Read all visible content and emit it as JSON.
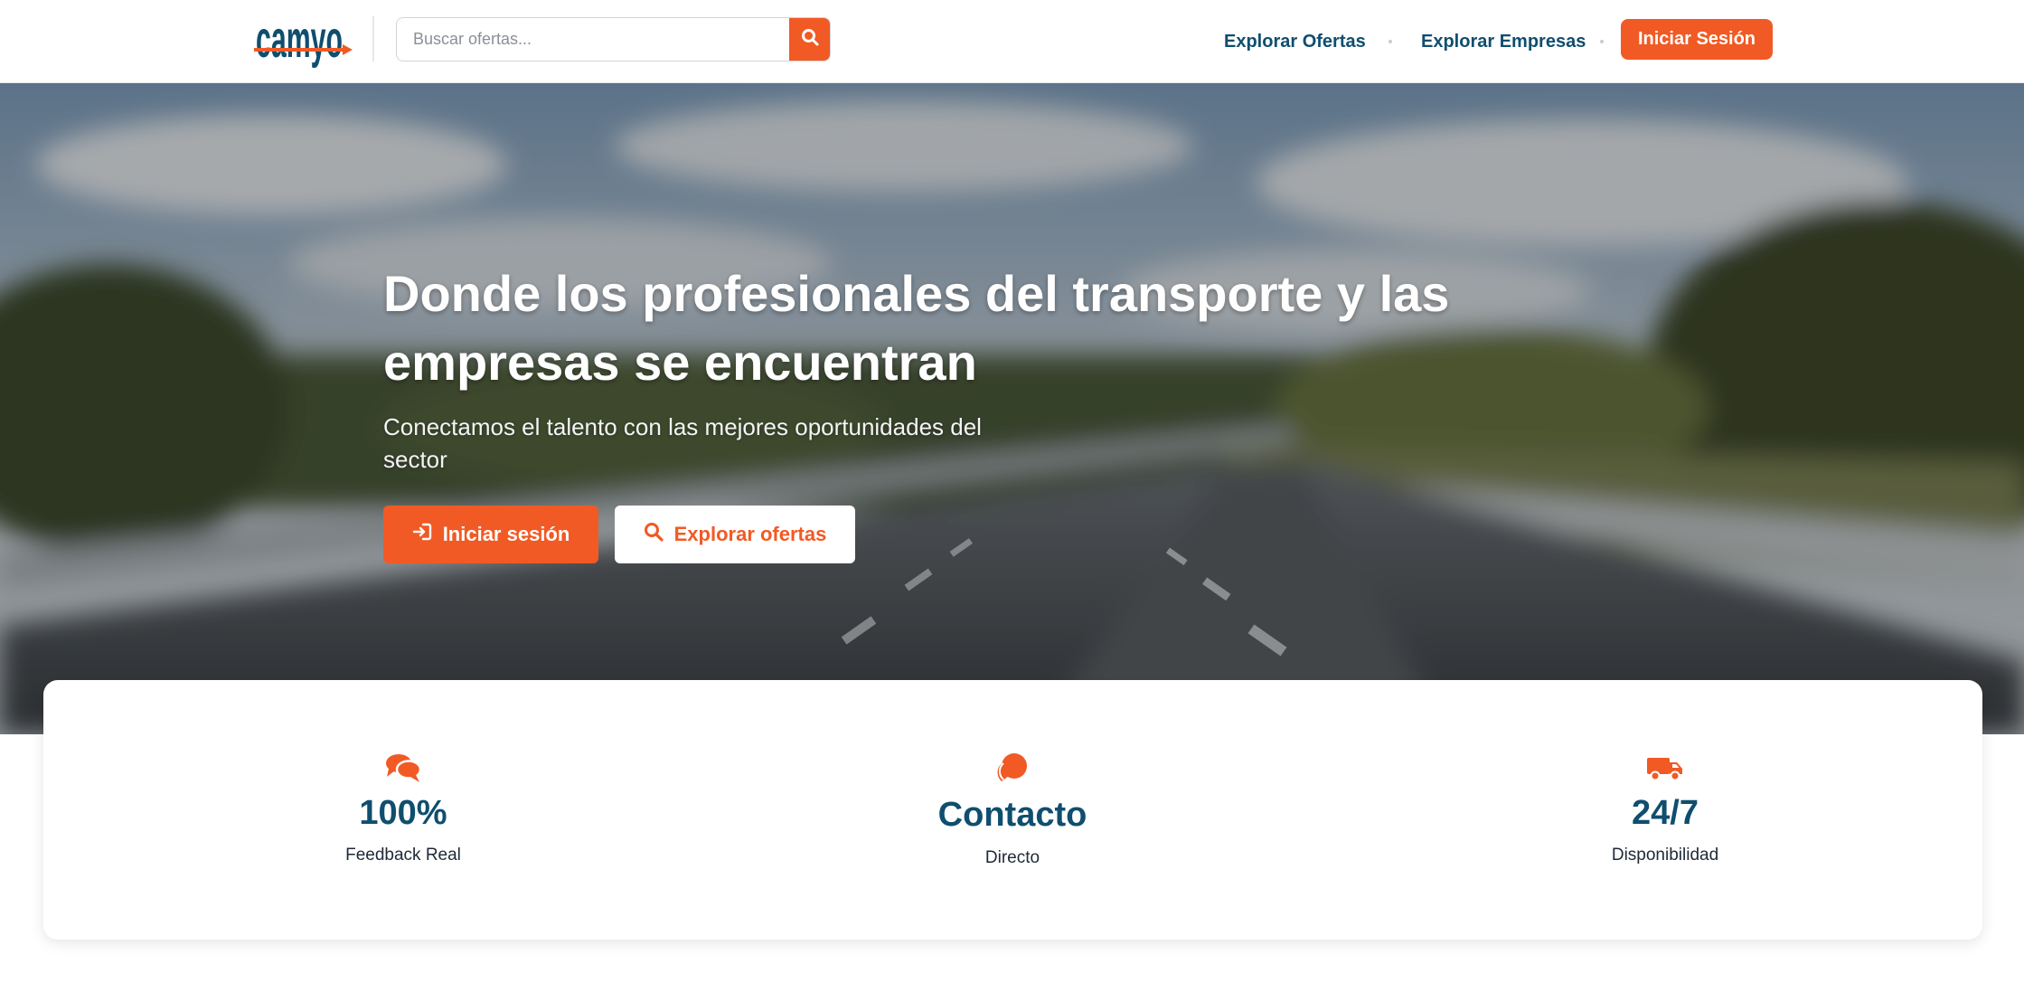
{
  "header": {
    "logo_text": "camyo",
    "search": {
      "placeholder": "Buscar ofertas...",
      "value": ""
    },
    "nav": [
      {
        "label": "Explorar Ofertas"
      },
      {
        "label": "Explorar Empresas"
      }
    ],
    "login_label": "Iniciar Sesión"
  },
  "hero": {
    "title": "Donde los profesionales del transporte y las empresas se encuentran",
    "subtitle": "Conectamos el talento con las mejores oportunidades del sector",
    "primary_button": "Iniciar sesión",
    "secondary_button": "Explorar ofertas"
  },
  "stats": [
    {
      "icon": "comments-icon",
      "value": "100%",
      "label": "Feedback Real"
    },
    {
      "icon": "chat-bubble-icon",
      "value": "Contacto",
      "label": "Directo"
    },
    {
      "icon": "truck-icon",
      "value": "24/7",
      "label": "Disponibilidad"
    }
  ],
  "colors": {
    "accent": "#f15a24",
    "brand_navy": "#0f4e6e"
  }
}
